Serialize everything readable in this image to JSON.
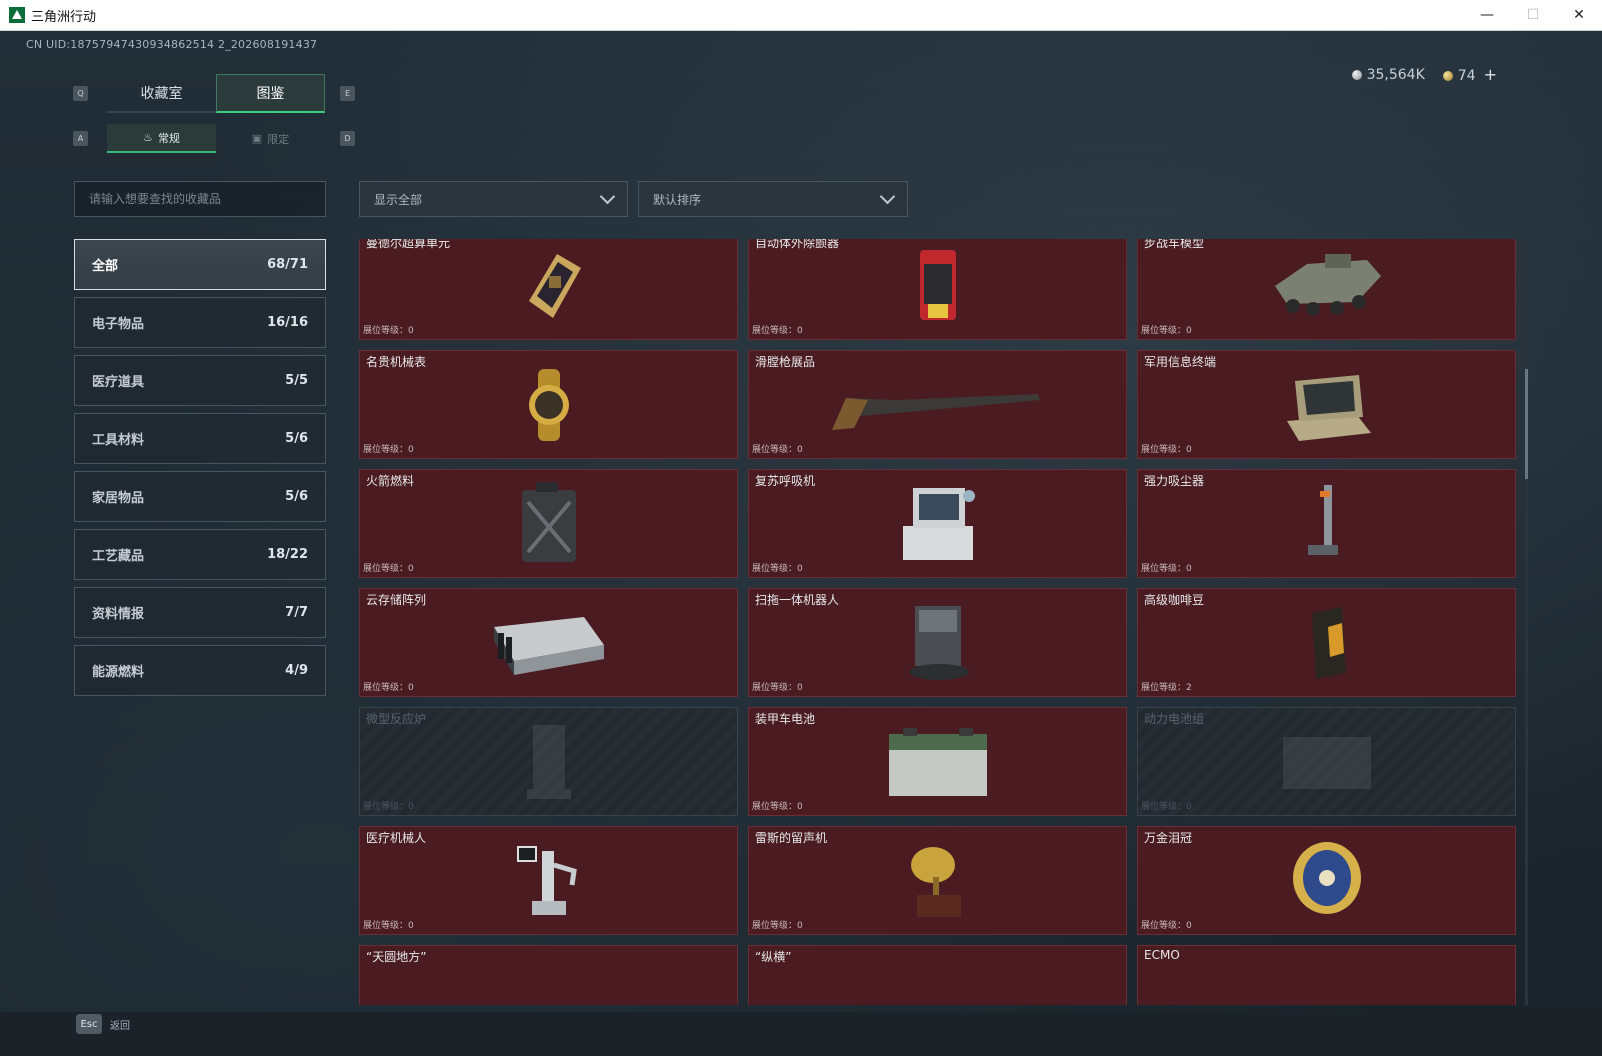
{
  "window": {
    "title": "三角洲行动",
    "minimize": "—",
    "maximize": "☐",
    "close": "✕"
  },
  "uid": "CN UID:18757947430934862514 2_202608191437",
  "currency": {
    "silver": "35,564K",
    "gold": "74",
    "plus": "+"
  },
  "keys": {
    "q": "Q",
    "e": "E",
    "a": "A",
    "d": "D"
  },
  "tabs": {
    "collection_room": "收藏室",
    "catalog": "图鉴"
  },
  "subtabs": {
    "regular": "常规",
    "limited": "限定"
  },
  "search": {
    "placeholder": "请输入想要查找的收藏品"
  },
  "filter": {
    "show": "显示全部",
    "sort": "默认排序"
  },
  "categories": [
    {
      "label": "全部",
      "count": "68/71"
    },
    {
      "label": "电子物品",
      "count": "16/16"
    },
    {
      "label": "医疗道具",
      "count": "5/5"
    },
    {
      "label": "工具材料",
      "count": "5/6"
    },
    {
      "label": "家居物品",
      "count": "5/6"
    },
    {
      "label": "工艺藏品",
      "count": "18/22"
    },
    {
      "label": "资料情报",
      "count": "7/7"
    },
    {
      "label": "能源燃料",
      "count": "4/9"
    }
  ],
  "items": [
    {
      "name": "曼德尔超算单元",
      "level": "展位等级：0",
      "art": "chip-icon"
    },
    {
      "name": "自动体外除颤器",
      "level": "展位等级：0",
      "art": "defibrillator-icon"
    },
    {
      "name": "步战车模型",
      "level": "展位等级：0",
      "art": "ifv-model-icon"
    },
    {
      "name": "名贵机械表",
      "level": "展位等级：0",
      "art": "watch-icon"
    },
    {
      "name": "滑膛枪展品",
      "level": "展位等级：0",
      "art": "musket-icon"
    },
    {
      "name": "军用信息终端",
      "level": "展位等级：0",
      "art": "terminal-icon"
    },
    {
      "name": "火箭燃料",
      "level": "展位等级：0",
      "art": "fuel-can-icon"
    },
    {
      "name": "复苏呼吸机",
      "level": "展位等级：0",
      "art": "ventilator-icon"
    },
    {
      "name": "强力吸尘器",
      "level": "展位等级：0",
      "art": "vacuum-icon"
    },
    {
      "name": "云存储阵列",
      "level": "展位等级：0",
      "art": "storage-array-icon"
    },
    {
      "name": "扫拖一体机器人",
      "level": "展位等级：0",
      "art": "robot-vacuum-icon"
    },
    {
      "name": "高级咖啡豆",
      "level": "展位等级：2",
      "art": "coffee-bag-icon"
    },
    {
      "name": "微型反应炉",
      "level": "展位等级：0",
      "art": "reactor-icon"
    },
    {
      "name": "装甲车电池",
      "level": "展位等级：0",
      "art": "battery-icon"
    },
    {
      "name": "动力电池组",
      "level": "展位等级：0",
      "art": "battery-pack-icon"
    },
    {
      "name": "医疗机械人",
      "level": "展位等级：0",
      "art": "medical-robot-icon"
    },
    {
      "name": "雷斯的留声机",
      "level": "展位等级：0",
      "art": "gramophone-icon"
    },
    {
      "name": "万金泪冠",
      "level": "展位等级：0",
      "art": "jeweled-egg-icon"
    },
    {
      "name": "“天圆地方”",
      "level": "",
      "art": "gold-object-icon"
    },
    {
      "name": "“纵横”",
      "level": "",
      "art": "gold-box-icon"
    },
    {
      "name": "ECMO",
      "level": "",
      "art": "ecmo-icon"
    }
  ],
  "back": {
    "key": "Esc",
    "label": "返回"
  }
}
